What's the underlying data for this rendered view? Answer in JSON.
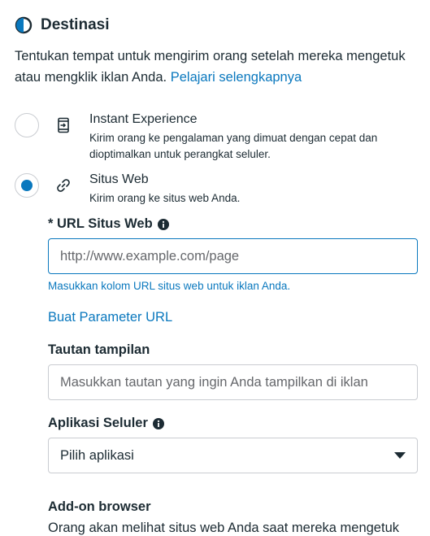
{
  "destination": {
    "title": "Destinasi",
    "description": "Tentukan tempat untuk mengirim orang setelah mereka mengetuk atau mengklik iklan Anda.",
    "learn_more": "Pelajari selengkapnya"
  },
  "options": [
    {
      "title": "Instant Experience",
      "description": "Kirim orang ke pengalaman yang dimuat dengan cepat dan dioptimalkan untuk perangkat seluler.",
      "selected": false,
      "icon": "instant-experience-icon"
    },
    {
      "title": "Situs Web",
      "description": "Kirim orang ke situs web Anda.",
      "selected": true,
      "icon": "link-icon"
    }
  ],
  "website_url": {
    "label": "* URL Situs Web",
    "placeholder": "http://www.example.com/page",
    "value": "",
    "hint": "Masukkan kolom URL situs web untuk iklan Anda."
  },
  "url_params_link": "Buat Parameter URL",
  "display_link": {
    "label": "Tautan tampilan",
    "placeholder": "Masukkan tautan yang ingin Anda tampilkan di iklan",
    "value": ""
  },
  "mobile_app": {
    "label": "Aplikasi Seluler",
    "selected": "Pilih aplikasi"
  },
  "addon_browser": {
    "title": "Add-on browser",
    "description": "Orang akan melihat situs web Anda saat mereka mengetuk"
  },
  "colors": {
    "accent": "#0a78be",
    "text": "#1c2b33",
    "border": "#c9ccd1"
  }
}
